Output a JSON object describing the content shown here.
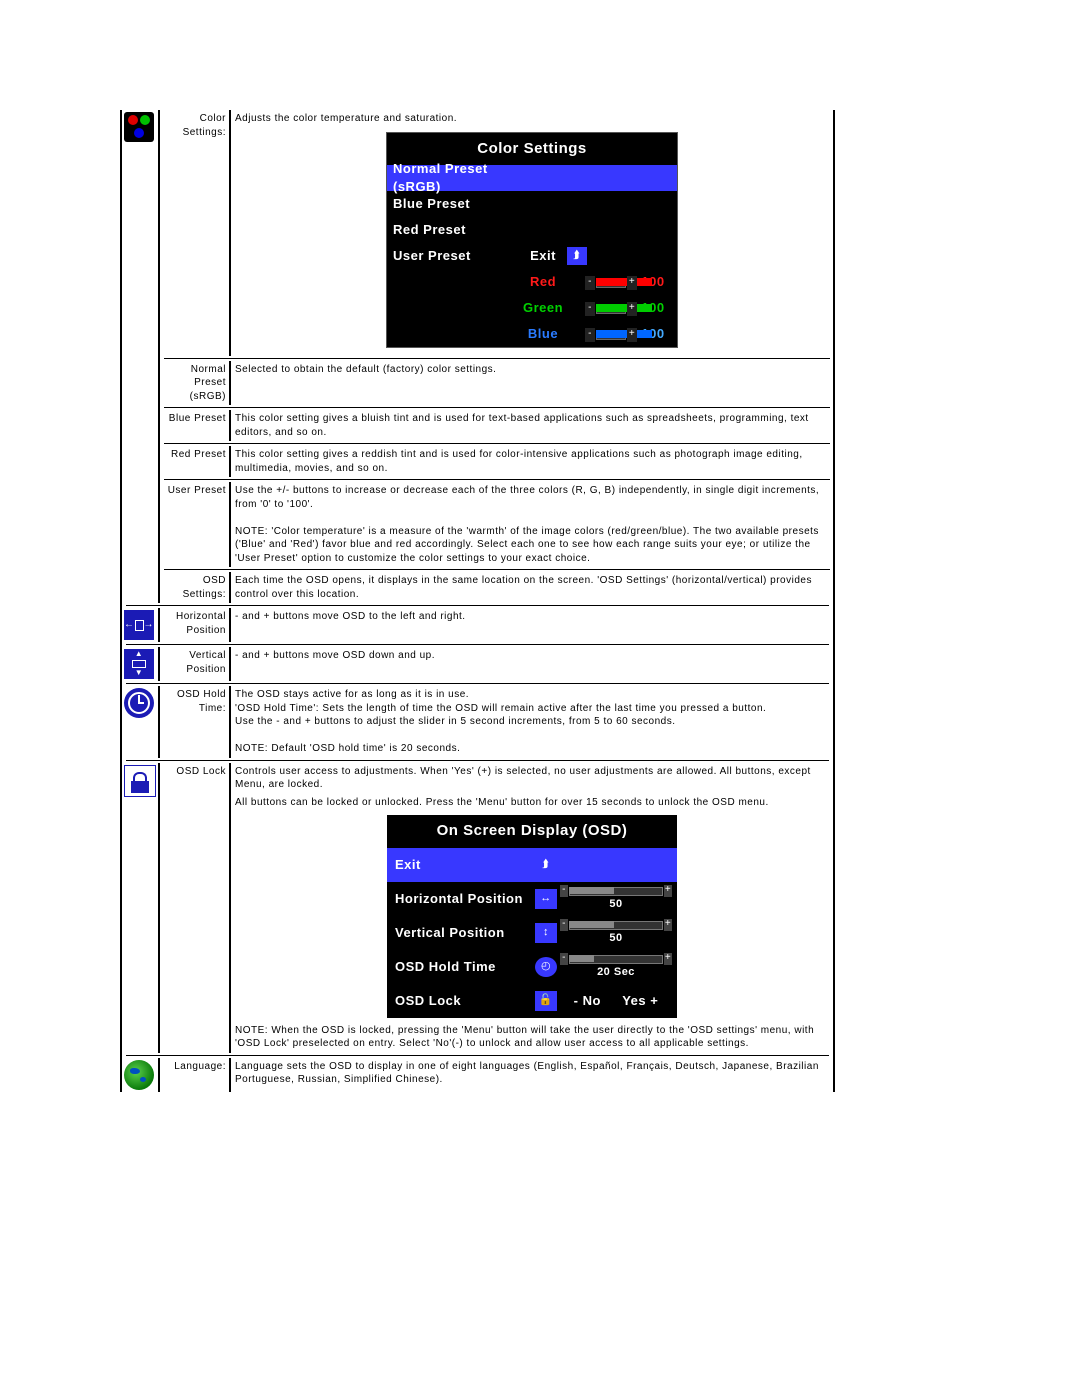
{
  "color_settings": {
    "label": "Color Settings:",
    "desc": "Adjusts the color temperature and saturation.",
    "osd": {
      "title": "Color Settings",
      "item_normal": "Normal Preset (sRGB)",
      "item_blue": "Blue Preset",
      "item_red": "Red Preset",
      "item_user": "User Preset",
      "exit": "Exit",
      "red": "Red",
      "green": "Green",
      "blue": "Blue",
      "val_red": "100",
      "val_green": "100",
      "val_blue": "100"
    },
    "normal_preset": {
      "label": "Normal Preset (sRGB)",
      "desc": "Selected to obtain the default (factory) color settings."
    },
    "blue_preset": {
      "label": "Blue Preset",
      "desc": "This color setting gives a bluish tint and is used for text-based applications such as spreadsheets, programming, text editors, and so on."
    },
    "red_preset": {
      "label": "Red Preset",
      "desc": "This color setting gives a reddish tint and is used for color-intensive applications such as photograph image editing, multimedia, movies, and so on."
    },
    "user_preset": {
      "label": "User Preset",
      "desc": "Use the +/- buttons to increase or decrease each of the three colors (R, G, B) independently, in single digit increments, from '0' to '100'.",
      "note": "NOTE: 'Color temperature' is a measure of the 'warmth' of the image colors (red/green/blue). The two available presets ('Blue' and 'Red') favor blue and red accordingly. Select each one to see how each range suits your eye; or utilize the 'User Preset' option to customize the color settings to your exact choice."
    }
  },
  "osd_settings": {
    "label": "OSD Settings:",
    "desc": "Each time the OSD opens, it displays in the same location on the screen. 'OSD Settings' (horizontal/vertical) provides control over this location.",
    "hpos": {
      "label": "Horizontal Position",
      "desc": "- and + buttons move OSD to the left and right."
    },
    "vpos": {
      "label": "Vertical Position",
      "desc": "- and + buttons move OSD down and up."
    },
    "hold": {
      "label": "OSD Hold Time:",
      "l1": "The OSD stays active for as long as it is in use.",
      "l2": "'OSD Hold Time': Sets the length of time the OSD will remain active after the last time you pressed a button.",
      "l3": "Use the - and + buttons to adjust the slider in 5 second increments, from 5 to 60 seconds.",
      "note": "NOTE: Default 'OSD hold time' is 20 seconds."
    },
    "lock": {
      "label": "OSD Lock",
      "desc": "Controls user access to adjustments. When 'Yes' (+) is selected, no user adjustments are allowed. All buttons, except Menu, are locked.",
      "desc2": "All buttons can be locked or unlocked. Press the 'Menu' button for over 15 seconds to unlock the OSD menu."
    },
    "osd": {
      "title": "On Screen Display (OSD)",
      "exit": "Exit",
      "hpos": "Horizontal Position",
      "vpos": "Vertical  Position",
      "hold": "OSD Hold Time",
      "lock": "OSD Lock",
      "v_hpos": "50",
      "v_vpos": "50",
      "v_hold": "20 Sec",
      "no": "- No",
      "yes": "Yes +"
    },
    "note2": "NOTE: When the OSD is locked, pressing the 'Menu' button will take the user directly to the 'OSD settings' menu, with 'OSD Lock' preselected on entry. Select 'No'(-) to unlock and allow user access to all applicable settings."
  },
  "language": {
    "label": "Language:",
    "desc": "Language sets the OSD to display in one of eight languages (English, Español, Français, Deutsch, Japanese, Brazilian Portuguese, Russian, Simplified Chinese)."
  }
}
